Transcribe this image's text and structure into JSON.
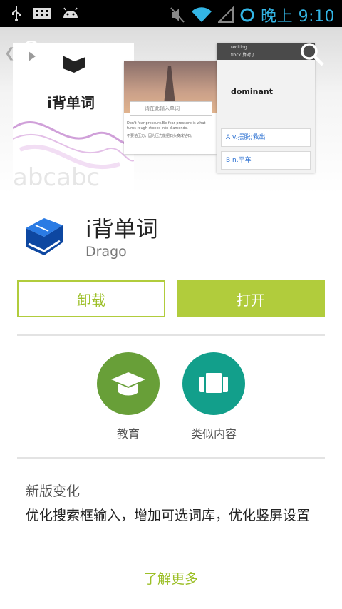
{
  "status_bar": {
    "time": "晚上 9:10",
    "icons": [
      "usb-icon",
      "keyboard-icon",
      "android-icon",
      "mute-icon",
      "wifi-icon",
      "signal-icon",
      "sync-icon"
    ]
  },
  "header": {
    "screenshots": {
      "shot1_title": "i背单词",
      "shot2_search_placeholder": "请在此输入单词",
      "shot2_quote": "Don't fear pressure.Be fear pressure is what turns rough stones into diamonds.",
      "shot2_quote_cn": "不要怕压力，因为压力能把石头变成钻石。",
      "shot3_top_lines": [
        "reciting",
        "flock 算对了"
      ],
      "shot3_word": "dominant",
      "shot3_options": [
        "A  v.摆脱;救出",
        "B  n.平车"
      ]
    }
  },
  "app": {
    "title": "i背单词",
    "developer": "Drago"
  },
  "actions": {
    "uninstall_label": "卸载",
    "open_label": "打开"
  },
  "badges": [
    {
      "label": "教育",
      "color": "#689f38"
    },
    {
      "label": "类似内容",
      "color": "#129f8b"
    }
  ],
  "whats_new": {
    "title": "新版变化",
    "body": "优化搜索框输入，增加可选词库，优化竖屏设置",
    "more_label": "了解更多"
  },
  "colors": {
    "accent": "#b1cc3c",
    "status_time": "#33b5e5"
  }
}
